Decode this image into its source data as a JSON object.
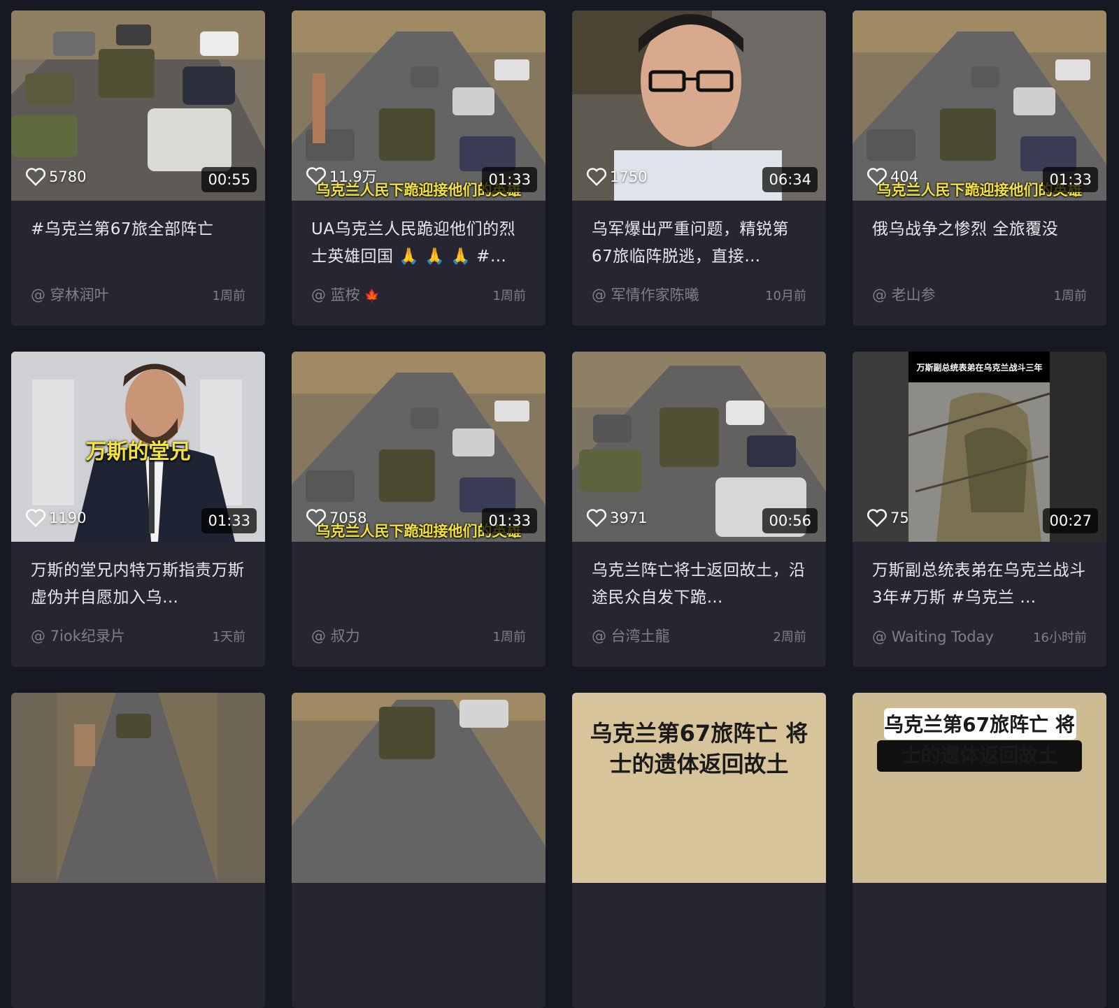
{
  "cards": [
    {
      "likes": "5780",
      "duration": "00:55",
      "title": "#乌克兰第67旅全部阵亡",
      "author": "@ 穿林润叶",
      "time": "1周前"
    },
    {
      "likes": "11.9万",
      "duration": "01:33",
      "title": "UA乌克兰人民跪迎他们的烈士英雄回国 🙏 🙏 🙏 #…",
      "author": "@ 蓝桉",
      "time": "1周前",
      "author_emoji": "🍁",
      "caption": "乌克兰人民下跪迎接他们的英雄"
    },
    {
      "likes": "1750",
      "duration": "06:34",
      "title": "乌军爆出严重问题，精锐第67旅临阵脱逃，直接…",
      "author": "@ 军情作家陈曦",
      "time": "10月前"
    },
    {
      "likes": "404",
      "duration": "01:33",
      "title": "俄乌战争之惨烈 全旅覆没",
      "author": "@ 老山参",
      "time": "1周前",
      "caption": "乌克兰人民下跪迎接他们的英雄"
    },
    {
      "likes": "1190",
      "duration": "01:33",
      "title": "万斯的堂兄内特万斯指责万斯虚伪并自愿加入乌…",
      "author": "@ 7iok纪录片",
      "time": "1天前",
      "overlay": "万斯的堂兄"
    },
    {
      "likes": "7058",
      "duration": "01:33",
      "title": "",
      "author": "@ 叔力",
      "time": "1周前",
      "caption": "乌克兰人民下跪迎接他们的英雄"
    },
    {
      "likes": "3971",
      "duration": "00:56",
      "title": "乌克兰阵亡将士返回故土，沿途民众自发下跪…",
      "author": "@ 台湾土龍",
      "time": "2周前"
    },
    {
      "likes": "75",
      "duration": "00:27",
      "title": "万斯副总统表弟在乌克兰战斗3年#万斯 #乌克兰 …",
      "author": "@ Waiting Today",
      "time": "16小时前",
      "overlay": "万斯副总统表弟在乌克兰战斗三年"
    }
  ],
  "partial_cards": [
    {
      "overlay": ""
    },
    {
      "overlay": ""
    },
    {
      "overlay": "乌克兰第67旅阵亡 将士的遗体返回故土"
    },
    {
      "overlay": "乌克兰第67旅阵亡 将士的遗体返回故土"
    }
  ],
  "colors": {
    "background": "#161823",
    "card": "#252632",
    "caption": "#f3e23a"
  }
}
